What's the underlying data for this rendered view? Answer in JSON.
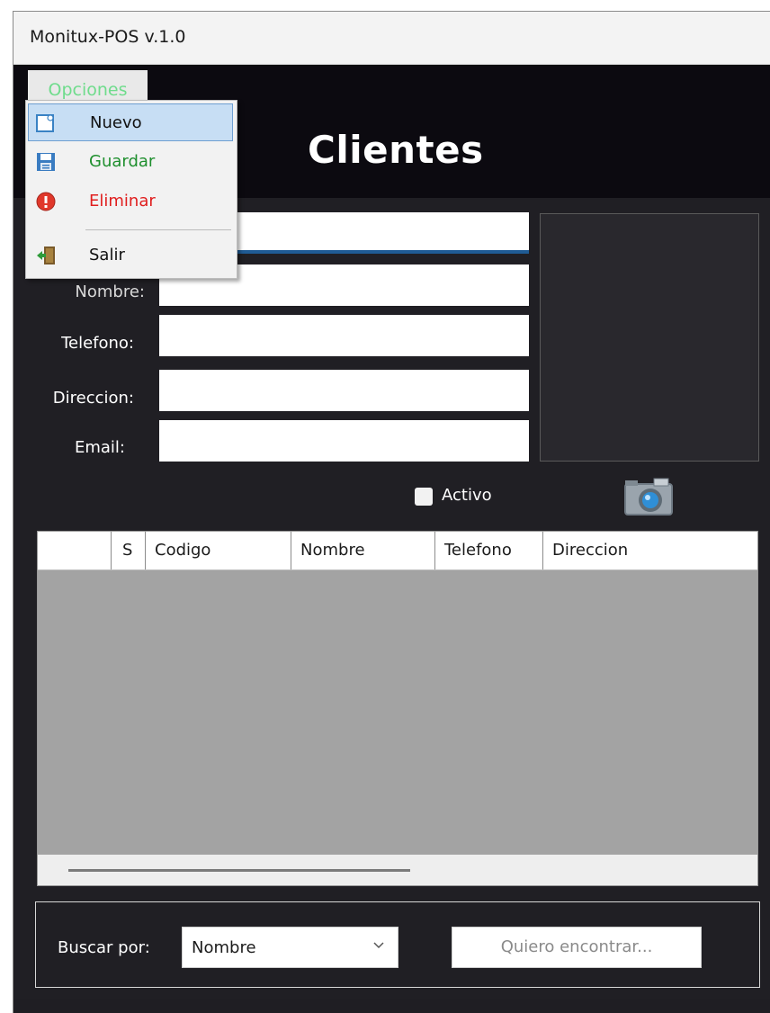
{
  "window": {
    "title": "Monitux-POS v.1.0"
  },
  "menu": {
    "root_label": "Opciones",
    "items": [
      {
        "label": "Nuevo",
        "icon": "new-document-icon"
      },
      {
        "label": "Guardar",
        "icon": "floppy-disk-icon"
      },
      {
        "label": "Eliminar",
        "icon": "error-stop-icon"
      },
      {
        "label": "Salir",
        "icon": "exit-door-icon"
      }
    ]
  },
  "header": {
    "title": "Clientes"
  },
  "form": {
    "labels": {
      "nombre": "Nombre:",
      "telefono": "Telefono:",
      "direccion": "Direccion:",
      "email": "Email:"
    },
    "activo_label": "Activo"
  },
  "grid": {
    "columns": [
      "",
      "S",
      "Codigo",
      "Nombre",
      "Telefono",
      "Direccion"
    ],
    "rows": []
  },
  "search": {
    "label": "Buscar por:",
    "selected": "Nombre",
    "button_label": "Quiero encontrar..."
  },
  "colors": {
    "menu_root_text": "#6fdc8c",
    "guardar_text": "#1f8f2e",
    "eliminar_text": "#e01e1e",
    "highlight": "#c7def4"
  }
}
